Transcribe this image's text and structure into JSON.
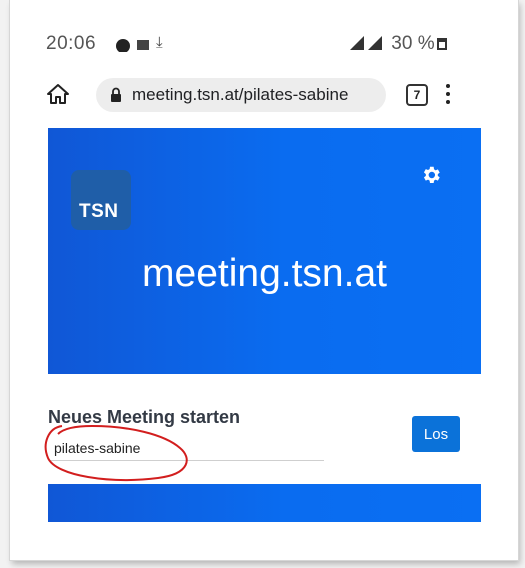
{
  "status_bar": {
    "time": "20:06",
    "battery": "30 %"
  },
  "browser": {
    "url": "meeting.tsn.at/pilates-sabine",
    "tab_count": "7"
  },
  "hero": {
    "logo_text": "TSN",
    "title": "meeting.tsn.at"
  },
  "meeting_form": {
    "heading": "Neues Meeting starten",
    "room_name_value": "pilates-sabine",
    "start_button_label": "Los"
  },
  "colors": {
    "primary_blue": "#0a6cf0",
    "button_blue": "#0b72d9",
    "logo_tile": "#1f5ea8",
    "annotation_red": "#d21e1e"
  },
  "icons": [
    "home-icon",
    "lock-icon",
    "tabs-icon",
    "more-vert-icon",
    "gear-icon",
    "signal-icon",
    "battery-icon"
  ]
}
